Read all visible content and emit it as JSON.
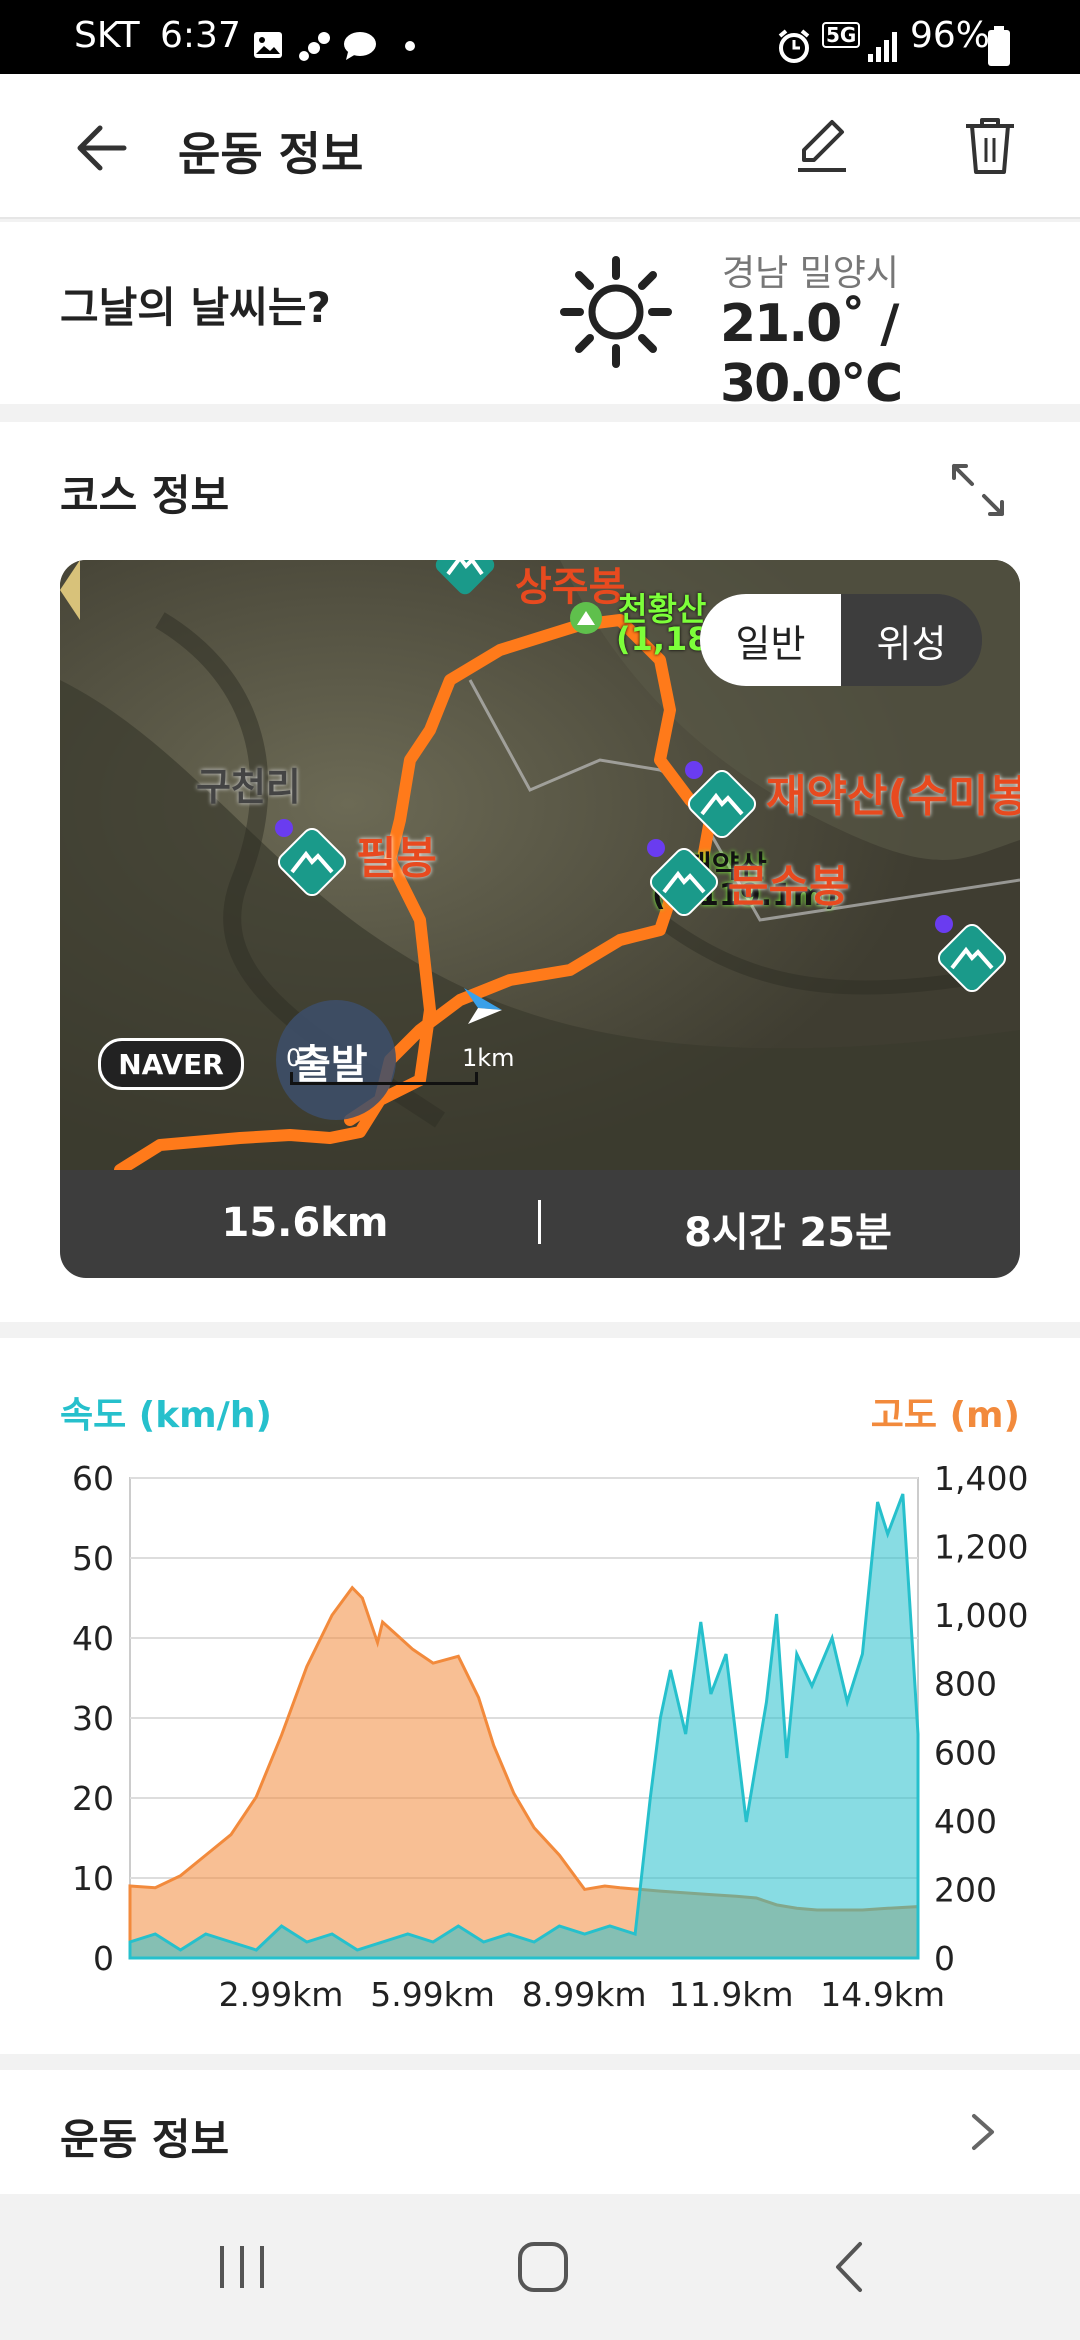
{
  "status_bar": {
    "carrier": "SKT",
    "time": "6:37",
    "network": "5G",
    "battery": "96%"
  },
  "header": {
    "title": "운동 정보"
  },
  "weather": {
    "question": "그날의 날씨는?",
    "location": "경남 밀양시",
    "temperature": "21.0˚ / 30.0℃",
    "icon": "sun-icon"
  },
  "course": {
    "section_title": "코스 정보",
    "map_toggle": {
      "normal": "일반",
      "satellite": "위성",
      "selected": "위성"
    },
    "map_labels": {
      "peak_top": "상주봉",
      "cheonhwang": "천황산",
      "cheonhwang_alt": "(1,189",
      "guchheon": "구천리",
      "pilbong": "필봉",
      "jaeyak_sumi": "재약산(수미봉",
      "jaeyak": "재약산",
      "jaeyak_alt": "(1,119.1m)",
      "munsu": "문수봉",
      "start": "출발",
      "naver": "NAVER",
      "scale_start": "0",
      "scale_end": "1km"
    },
    "distance": "15.6km",
    "duration": "8시간 25분"
  },
  "chart_data": {
    "type": "area",
    "left_axis_label": "속도 (km/h)",
    "right_axis_label": "고도 (m)",
    "left_ticks": [
      "60",
      "50",
      "40",
      "30",
      "20",
      "10",
      "0"
    ],
    "right_ticks": [
      "1,400",
      "1,200",
      "1,000",
      "800",
      "600",
      "400",
      "200",
      "0"
    ],
    "x_ticks": [
      "2.99km",
      "5.99km",
      "8.99km",
      "11.9km",
      "14.9km"
    ],
    "ylim_speed": [
      0,
      60
    ],
    "ylim_altitude": [
      0,
      1400
    ],
    "colors": {
      "speed": "#26c0cc",
      "altitude": "#f28a3c"
    },
    "series": [
      {
        "name": "고도 (m)",
        "axis": "right",
        "x": [
          0,
          0.5,
          1.0,
          1.5,
          2.0,
          2.5,
          3.0,
          3.5,
          4.0,
          4.4,
          4.6,
          4.9,
          5.0,
          5.3,
          5.6,
          6.0,
          6.5,
          6.9,
          7.2,
          7.6,
          8.0,
          8.5,
          9.0,
          9.4,
          9.7,
          10.1,
          10.5,
          11.0,
          11.5,
          12.0,
          12.4,
          12.8,
          13.2,
          13.6,
          14.0,
          14.5,
          15.0,
          15.6
        ],
        "values": [
          210,
          205,
          240,
          300,
          360,
          470,
          650,
          850,
          1000,
          1080,
          1050,
          920,
          980,
          940,
          900,
          860,
          880,
          760,
          620,
          480,
          380,
          300,
          200,
          210,
          205,
          200,
          195,
          190,
          185,
          180,
          175,
          155,
          145,
          140,
          140,
          140,
          145,
          150
        ]
      },
      {
        "name": "속도 (km/h)",
        "axis": "left",
        "x": [
          0,
          0.5,
          1.0,
          1.5,
          2.0,
          2.5,
          3.0,
          3.5,
          4.0,
          4.5,
          5.0,
          5.5,
          6.0,
          6.5,
          7.0,
          7.5,
          8.0,
          8.5,
          9.0,
          9.5,
          10.0,
          10.3,
          10.5,
          10.7,
          11.0,
          11.3,
          11.5,
          11.8,
          12.2,
          12.6,
          12.8,
          13.0,
          13.2,
          13.5,
          13.9,
          14.2,
          14.5,
          14.8,
          15.0,
          15.3,
          15.6
        ],
        "values": [
          2,
          3,
          1,
          3,
          2,
          1,
          4,
          2,
          3,
          1,
          2,
          3,
          2,
          4,
          2,
          3,
          2,
          4,
          3,
          4,
          3,
          20,
          30,
          36,
          28,
          42,
          33,
          38,
          17,
          32,
          43,
          25,
          38,
          34,
          40,
          32,
          38,
          57,
          53,
          58,
          28
        ]
      }
    ]
  },
  "exercise": {
    "section_title": "운동 정보"
  }
}
